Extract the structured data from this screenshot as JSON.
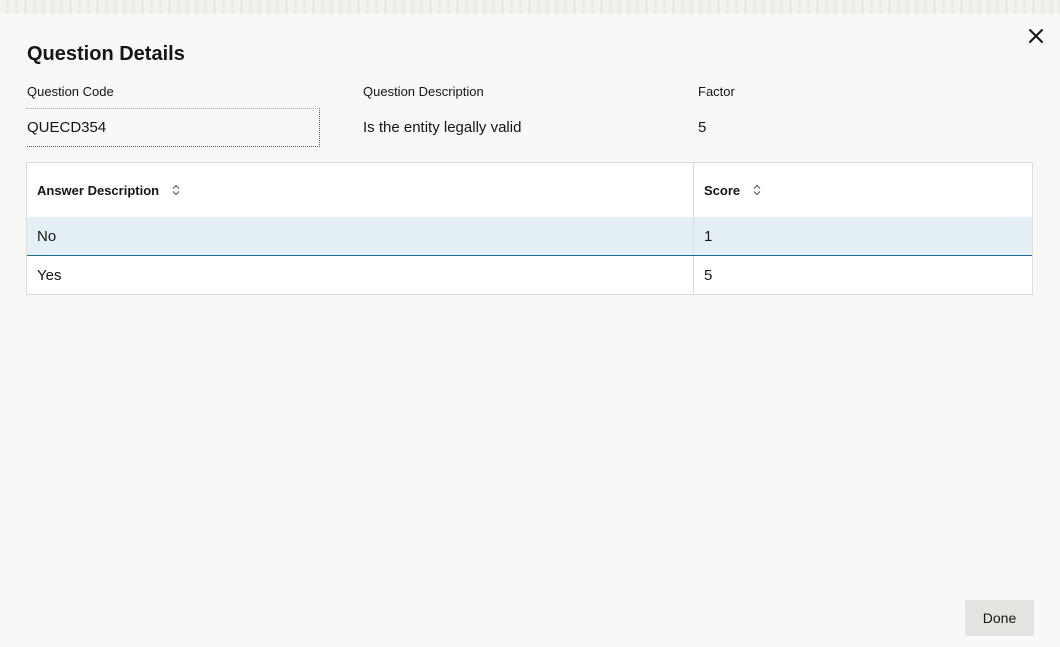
{
  "dialog": {
    "title": "Question Details"
  },
  "fields": {
    "code_label": "Question Code",
    "code_value": "QUECD354",
    "description_label": "Question Description",
    "description_value": "Is the entity legally valid",
    "factor_label": "Factor",
    "factor_value": "5"
  },
  "table": {
    "columns": [
      "Answer Description",
      "Score"
    ],
    "rows": [
      {
        "answer": "No",
        "score": "1",
        "selected": true
      },
      {
        "answer": "Yes",
        "score": "5",
        "selected": false
      }
    ]
  },
  "footer": {
    "done_label": "Done"
  },
  "icons": {
    "close": "close-icon",
    "sort": "sort-icon"
  },
  "colors": {
    "selected_row": "#e4f0f5",
    "selected_border": "#1a6e95",
    "button_bg": "#e4e3df"
  }
}
